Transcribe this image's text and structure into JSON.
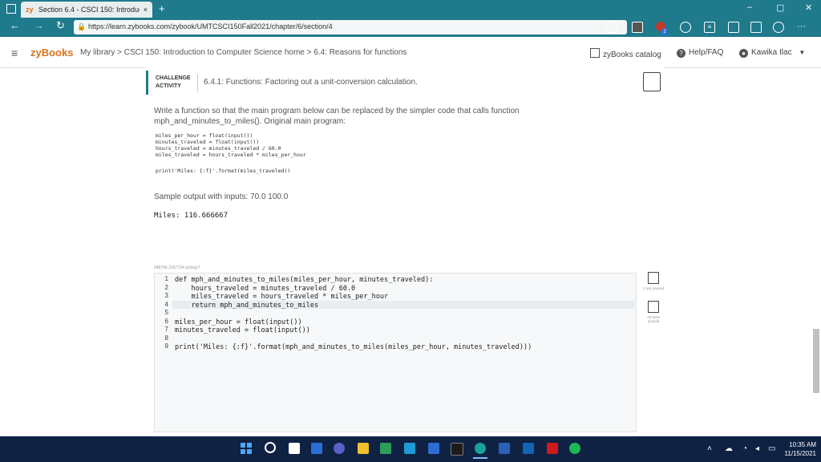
{
  "browser": {
    "tab_logo": "zy",
    "tab_title": "Section 6.4 - CSCI 150: Introducti",
    "tab_close": "×",
    "new_tab": "+",
    "url": "https://learn.zybooks.com/zybook/UMTCSCI150Fall2021/chapter/6/section/4",
    "window_controls": [
      "–",
      "▢",
      "✕"
    ],
    "nav": [
      "←",
      "→",
      "↻"
    ],
    "more_menu": "···",
    "badge_count": "2"
  },
  "header": {
    "logo": "zyBooks",
    "breadcrumb": "My library > CSCI 150: Introduction to Computer Science home > 6.4: Reasons for functions",
    "catalog_label": "zyBooks catalog",
    "help_label": "Help/FAQ",
    "user_name": "Kawika Ilac"
  },
  "activity": {
    "type_label": "CHALLENGE ACTIVITY",
    "title": "6.4.1: Functions: Factoring out a unit-conversion calculation.",
    "instructions": "Write a function so that the main program below can be replaced by the simpler code that calls function mph_and_minutes_to_miles(). Original main program:",
    "original_code": "miles_per_hour = float(input())\nminutes_traveled = float(input())\nhours_traveled = minutes_traveled / 60.0\nmiles_traveled = hours_traveled * miles_per_hour",
    "original_print": "print('Miles: {:f}'.format(miles_traveled))",
    "sample_label": "Sample output with inputs: 70.0 100.0",
    "sample_output": "Miles: 116.666667",
    "code_id": "348766.2167724.qx3zqy7"
  },
  "editor": {
    "line_numbers": [
      "1",
      "2",
      "3",
      "4",
      "5",
      "6",
      "7",
      "8",
      "9"
    ],
    "lines": [
      "def mph_and_minutes_to_miles(miles_per_hour, minutes_traveled):",
      "    hours_traveled = minutes_traveled / 60.0",
      "    miles_traveled = hours_traveled * miles_per_hour",
      "    return mph_and_minutes_to_miles",
      "",
      "miles_per_hour = float(input())",
      "minutes_traveled = float(input())",
      "",
      "print('Miles: {:f}'.format(mph_and_minutes_to_miles(miles_per_hour, minutes_traveled)))"
    ],
    "status_1": "1 test passed",
    "status_2": "All tests passed"
  },
  "taskbar": {
    "time": "10:35 AM",
    "date": "11/15/2021"
  },
  "colors": {
    "browser_chrome": "#1f7a8c",
    "brand": "#d9731c",
    "taskbar": "#0f2244"
  }
}
